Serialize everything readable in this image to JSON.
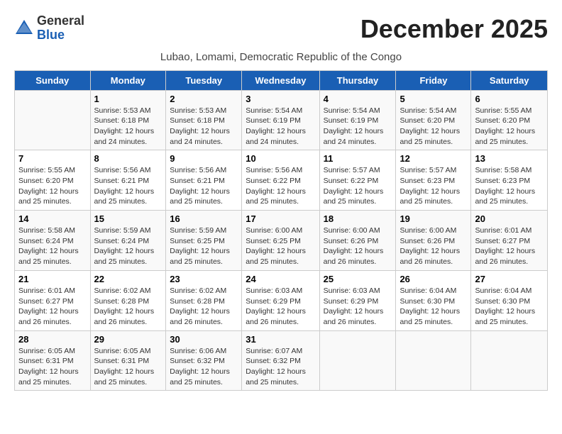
{
  "header": {
    "logo_line1": "General",
    "logo_line2": "Blue",
    "month_title": "December 2025",
    "subtitle": "Lubao, Lomami, Democratic Republic of the Congo"
  },
  "weekdays": [
    "Sunday",
    "Monday",
    "Tuesday",
    "Wednesday",
    "Thursday",
    "Friday",
    "Saturday"
  ],
  "weeks": [
    [
      {
        "day": "",
        "info": ""
      },
      {
        "day": "1",
        "info": "Sunrise: 5:53 AM\nSunset: 6:18 PM\nDaylight: 12 hours\nand 24 minutes."
      },
      {
        "day": "2",
        "info": "Sunrise: 5:53 AM\nSunset: 6:18 PM\nDaylight: 12 hours\nand 24 minutes."
      },
      {
        "day": "3",
        "info": "Sunrise: 5:54 AM\nSunset: 6:19 PM\nDaylight: 12 hours\nand 24 minutes."
      },
      {
        "day": "4",
        "info": "Sunrise: 5:54 AM\nSunset: 6:19 PM\nDaylight: 12 hours\nand 24 minutes."
      },
      {
        "day": "5",
        "info": "Sunrise: 5:54 AM\nSunset: 6:20 PM\nDaylight: 12 hours\nand 25 minutes."
      },
      {
        "day": "6",
        "info": "Sunrise: 5:55 AM\nSunset: 6:20 PM\nDaylight: 12 hours\nand 25 minutes."
      }
    ],
    [
      {
        "day": "7",
        "info": "Sunrise: 5:55 AM\nSunset: 6:20 PM\nDaylight: 12 hours\nand 25 minutes."
      },
      {
        "day": "8",
        "info": "Sunrise: 5:56 AM\nSunset: 6:21 PM\nDaylight: 12 hours\nand 25 minutes."
      },
      {
        "day": "9",
        "info": "Sunrise: 5:56 AM\nSunset: 6:21 PM\nDaylight: 12 hours\nand 25 minutes."
      },
      {
        "day": "10",
        "info": "Sunrise: 5:56 AM\nSunset: 6:22 PM\nDaylight: 12 hours\nand 25 minutes."
      },
      {
        "day": "11",
        "info": "Sunrise: 5:57 AM\nSunset: 6:22 PM\nDaylight: 12 hours\nand 25 minutes."
      },
      {
        "day": "12",
        "info": "Sunrise: 5:57 AM\nSunset: 6:23 PM\nDaylight: 12 hours\nand 25 minutes."
      },
      {
        "day": "13",
        "info": "Sunrise: 5:58 AM\nSunset: 6:23 PM\nDaylight: 12 hours\nand 25 minutes."
      }
    ],
    [
      {
        "day": "14",
        "info": "Sunrise: 5:58 AM\nSunset: 6:24 PM\nDaylight: 12 hours\nand 25 minutes."
      },
      {
        "day": "15",
        "info": "Sunrise: 5:59 AM\nSunset: 6:24 PM\nDaylight: 12 hours\nand 25 minutes."
      },
      {
        "day": "16",
        "info": "Sunrise: 5:59 AM\nSunset: 6:25 PM\nDaylight: 12 hours\nand 25 minutes."
      },
      {
        "day": "17",
        "info": "Sunrise: 6:00 AM\nSunset: 6:25 PM\nDaylight: 12 hours\nand 25 minutes."
      },
      {
        "day": "18",
        "info": "Sunrise: 6:00 AM\nSunset: 6:26 PM\nDaylight: 12 hours\nand 26 minutes."
      },
      {
        "day": "19",
        "info": "Sunrise: 6:00 AM\nSunset: 6:26 PM\nDaylight: 12 hours\nand 26 minutes."
      },
      {
        "day": "20",
        "info": "Sunrise: 6:01 AM\nSunset: 6:27 PM\nDaylight: 12 hours\nand 26 minutes."
      }
    ],
    [
      {
        "day": "21",
        "info": "Sunrise: 6:01 AM\nSunset: 6:27 PM\nDaylight: 12 hours\nand 26 minutes."
      },
      {
        "day": "22",
        "info": "Sunrise: 6:02 AM\nSunset: 6:28 PM\nDaylight: 12 hours\nand 26 minutes."
      },
      {
        "day": "23",
        "info": "Sunrise: 6:02 AM\nSunset: 6:28 PM\nDaylight: 12 hours\nand 26 minutes."
      },
      {
        "day": "24",
        "info": "Sunrise: 6:03 AM\nSunset: 6:29 PM\nDaylight: 12 hours\nand 26 minutes."
      },
      {
        "day": "25",
        "info": "Sunrise: 6:03 AM\nSunset: 6:29 PM\nDaylight: 12 hours\nand 26 minutes."
      },
      {
        "day": "26",
        "info": "Sunrise: 6:04 AM\nSunset: 6:30 PM\nDaylight: 12 hours\nand 25 minutes."
      },
      {
        "day": "27",
        "info": "Sunrise: 6:04 AM\nSunset: 6:30 PM\nDaylight: 12 hours\nand 25 minutes."
      }
    ],
    [
      {
        "day": "28",
        "info": "Sunrise: 6:05 AM\nSunset: 6:31 PM\nDaylight: 12 hours\nand 25 minutes."
      },
      {
        "day": "29",
        "info": "Sunrise: 6:05 AM\nSunset: 6:31 PM\nDaylight: 12 hours\nand 25 minutes."
      },
      {
        "day": "30",
        "info": "Sunrise: 6:06 AM\nSunset: 6:32 PM\nDaylight: 12 hours\nand 25 minutes."
      },
      {
        "day": "31",
        "info": "Sunrise: 6:07 AM\nSunset: 6:32 PM\nDaylight: 12 hours\nand 25 minutes."
      },
      {
        "day": "",
        "info": ""
      },
      {
        "day": "",
        "info": ""
      },
      {
        "day": "",
        "info": ""
      }
    ]
  ]
}
